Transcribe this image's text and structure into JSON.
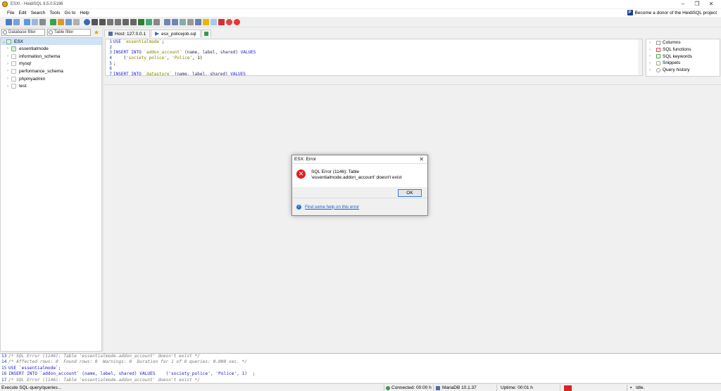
{
  "window": {
    "title": "ESX\\ - HeidiSQL 9.5.0.5196"
  },
  "menu": [
    "File",
    "Edit",
    "Search",
    "Tools",
    "Go to",
    "Help"
  ],
  "donor_label": "Become a donor of the HeidiSQL project",
  "filters": {
    "database_placeholder": "Database filter",
    "table_placeholder": "Table filter"
  },
  "tree": {
    "root": "ESX",
    "databases": [
      "essentialmode",
      "information_schema",
      "mysql",
      "performance_schema",
      "phpmyadmin",
      "test"
    ]
  },
  "tabs": [
    "Host: 127.0.0.1",
    "esx_policejob.sql"
  ],
  "editor_lines": [
    {
      "n": "1",
      "parts": [
        [
          "kw",
          "USE "
        ],
        [
          "str",
          "`essentialmode`"
        ],
        [
          "",
          ";"
        ]
      ]
    },
    {
      "n": "2",
      "parts": []
    },
    {
      "n": "3",
      "parts": [
        [
          "kw",
          "INSERT INTO "
        ],
        [
          "str",
          "`addon_account`"
        ],
        [
          "ident",
          " (name, label, shared) "
        ],
        [
          "kw",
          "VALUES"
        ]
      ]
    },
    {
      "n": "4",
      "parts": [
        [
          "",
          "    ("
        ],
        [
          "str",
          "'society_police'"
        ],
        [
          "",
          ", "
        ],
        [
          "str",
          "'Police'"
        ],
        [
          "",
          ", 1)"
        ]
      ]
    },
    {
      "n": "5",
      "parts": [
        [
          "",
          ";"
        ]
      ]
    },
    {
      "n": "6",
      "parts": []
    },
    {
      "n": "7",
      "parts": [
        [
          "kw",
          "INSERT INTO "
        ],
        [
          "str",
          "`datastore`"
        ],
        [
          "ident",
          " (name, label, shared) "
        ],
        [
          "kw",
          "VALUES"
        ]
      ]
    }
  ],
  "helper_items": [
    "Columns",
    "SQL functions",
    "SQL keywords",
    "Snippets",
    "Query history"
  ],
  "log_lines": [
    {
      "n": "13",
      "text": "/* SQL Error (1146): Table 'essentialmode.addon_account' doesn't exist */",
      "style": "cmt"
    },
    {
      "n": "14",
      "text": "/* Affected rows: 0  Found rows: 0  Warnings: 0  Duration for 1 of 8 queries: 0.000 sec. */",
      "style": "cmt"
    },
    {
      "n": "15",
      "text": "USE `essentialmode`;",
      "style": "code"
    },
    {
      "n": "16",
      "text": "INSERT INTO `addon_account` (name, label, shared) VALUES    ('society_police', 'Police', 1)  ;",
      "style": "code"
    },
    {
      "n": "17",
      "text": "/* SQL Error (1146): Table 'essentialmode.addon_account' doesn't exist */",
      "style": "cmt"
    }
  ],
  "status": {
    "left": "Execute SQL-query/queries...",
    "connected": "Connected: 00:00 h",
    "server": "MariaDB 10.1.37",
    "uptime": "Uptime: 00:01 h",
    "state": "Idle.",
    "indicator_color": "#e02020"
  },
  "dialog": {
    "title": "ESX: Error",
    "message": "SQL Error (1146): Table 'essentialmode.addon_account' doesn't exist",
    "ok_label": "OK",
    "help_link": "Find some help on this error"
  },
  "icons": [
    "app-icon",
    "paypal-icon",
    "search-icon",
    "star-icon",
    "database-icon",
    "error-icon",
    "help-icon",
    "play-icon"
  ]
}
